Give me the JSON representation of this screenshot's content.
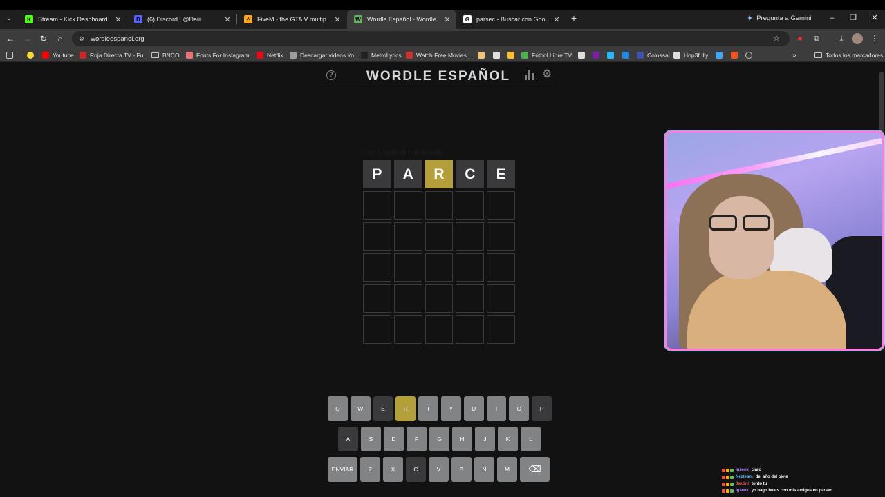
{
  "browser": {
    "tabs": [
      {
        "title": "Stream - Kick Dashboard",
        "favicon_color": "#53fc18",
        "favicon_glyph": "K",
        "active": false
      },
      {
        "title": "(6) Discord | @Daiii",
        "favicon_color": "#5865f2",
        "favicon_glyph": "D",
        "active": false
      },
      {
        "title": "FiveM - the GTA V multiplayer m",
        "favicon_color": "#f9a825",
        "favicon_glyph": "^",
        "active": false
      },
      {
        "title": "Wordle Español - Wordle ilimita",
        "favicon_color": "#6aaa64",
        "favicon_glyph": "W",
        "active": true
      },
      {
        "title": "parsec - Buscar con Google",
        "favicon_color": "#ffffff",
        "favicon_glyph": "G",
        "active": false
      }
    ],
    "gemini_label": "Pregunta a Gemini",
    "url": "wordleespanol.org",
    "bookmarks": [
      {
        "label": "Youtube",
        "color": "#ff0000"
      },
      {
        "label": "Roja Directa TV - Fu...",
        "color": "#c62828"
      },
      {
        "label": "BNCO",
        "folder": true
      },
      {
        "label": "Fonts For Instagram...",
        "color": "#e57373"
      },
      {
        "label": "Netflix",
        "color": "#e50914"
      },
      {
        "label": "Descargar videos Yo...",
        "color": "#9e9e9e"
      },
      {
        "label": "MetroLyrics",
        "color": "#212121"
      },
      {
        "label": "Watch Free Movies...",
        "color": "#d32f2f"
      },
      {
        "label": "Fútbol Libre TV",
        "color": "#4caf50"
      },
      {
        "label": "Colossal",
        "color": "#3f51b5"
      },
      {
        "label": "Hop3fully",
        "color": "#e0e0e0"
      }
    ],
    "all_bookmarks_label": "Todos los marcadores"
  },
  "game": {
    "title": "WORDLE ESPAÑOL",
    "ghost_text": "Por amplitud del diseño",
    "colors": {
      "present": "#b59f3b",
      "absent": "#3a3a3c",
      "unused": "#818384"
    },
    "board": [
      [
        {
          "letter": "P",
          "state": "absent"
        },
        {
          "letter": "A",
          "state": "absent"
        },
        {
          "letter": "R",
          "state": "present"
        },
        {
          "letter": "C",
          "state": "absent"
        },
        {
          "letter": "E",
          "state": "absent"
        }
      ],
      [
        {
          "letter": "",
          "state": "empty"
        },
        {
          "letter": "",
          "state": "empty"
        },
        {
          "letter": "",
          "state": "empty"
        },
        {
          "letter": "",
          "state": "empty"
        },
        {
          "letter": "",
          "state": "empty"
        }
      ],
      [
        {
          "letter": "",
          "state": "empty"
        },
        {
          "letter": "",
          "state": "empty"
        },
        {
          "letter": "",
          "state": "empty"
        },
        {
          "letter": "",
          "state": "empty"
        },
        {
          "letter": "",
          "state": "empty"
        }
      ],
      [
        {
          "letter": "",
          "state": "empty"
        },
        {
          "letter": "",
          "state": "empty"
        },
        {
          "letter": "",
          "state": "empty"
        },
        {
          "letter": "",
          "state": "empty"
        },
        {
          "letter": "",
          "state": "empty"
        }
      ],
      [
        {
          "letter": "",
          "state": "empty"
        },
        {
          "letter": "",
          "state": "empty"
        },
        {
          "letter": "",
          "state": "empty"
        },
        {
          "letter": "",
          "state": "empty"
        },
        {
          "letter": "",
          "state": "empty"
        }
      ],
      [
        {
          "letter": "",
          "state": "empty"
        },
        {
          "letter": "",
          "state": "empty"
        },
        {
          "letter": "",
          "state": "empty"
        },
        {
          "letter": "",
          "state": "empty"
        },
        {
          "letter": "",
          "state": "empty"
        }
      ]
    ],
    "keyboard": [
      [
        {
          "key": "Q",
          "state": "unused"
        },
        {
          "key": "W",
          "state": "unused"
        },
        {
          "key": "E",
          "state": "absent"
        },
        {
          "key": "R",
          "state": "present"
        },
        {
          "key": "T",
          "state": "unused"
        },
        {
          "key": "Y",
          "state": "unused"
        },
        {
          "key": "U",
          "state": "unused"
        },
        {
          "key": "I",
          "state": "unused"
        },
        {
          "key": "O",
          "state": "unused"
        },
        {
          "key": "P",
          "state": "absent"
        }
      ],
      [
        {
          "key": "A",
          "state": "absent"
        },
        {
          "key": "S",
          "state": "unused"
        },
        {
          "key": "D",
          "state": "unused"
        },
        {
          "key": "F",
          "state": "unused"
        },
        {
          "key": "G",
          "state": "unused"
        },
        {
          "key": "H",
          "state": "unused"
        },
        {
          "key": "J",
          "state": "unused"
        },
        {
          "key": "K",
          "state": "unused"
        },
        {
          "key": "L",
          "state": "unused"
        }
      ],
      [
        {
          "key": "ENVIAR",
          "state": "unused",
          "wide": true
        },
        {
          "key": "Z",
          "state": "unused"
        },
        {
          "key": "X",
          "state": "unused"
        },
        {
          "key": "C",
          "state": "absent"
        },
        {
          "key": "V",
          "state": "unused"
        },
        {
          "key": "B",
          "state": "unused"
        },
        {
          "key": "N",
          "state": "unused"
        },
        {
          "key": "M",
          "state": "unused"
        },
        {
          "key": "⌫",
          "state": "unused",
          "wide": true
        }
      ]
    ]
  },
  "chat": [
    {
      "user": "Igseek",
      "user_color": "#b388ff",
      "message": "claro"
    },
    {
      "user": "Nezteam",
      "user_color": "#64b5f6",
      "message": "del año del ojete"
    },
    {
      "user": "Jaxtini",
      "user_color": "#ef5350",
      "message": "tonto tu"
    },
    {
      "user": "Igseek",
      "user_color": "#b388ff",
      "message": "yo hago beats con mis amigos en parsec"
    }
  ]
}
